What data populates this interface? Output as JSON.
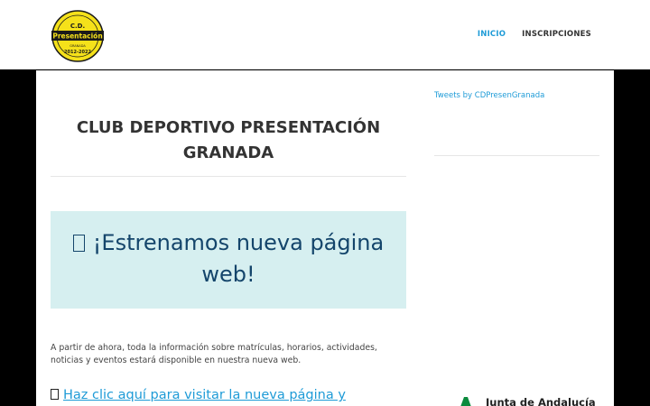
{
  "header": {
    "logo": {
      "line1": "C.D.",
      "line2": "Presentación",
      "line3": "GRANADA",
      "line4": "2012-2022",
      "colors": {
        "ring": "#f5e11a",
        "band": "#1a1a1a"
      }
    },
    "nav": [
      {
        "label": "INICIO",
        "active": true
      },
      {
        "label": "INSCRIPCIONES",
        "active": false
      }
    ]
  },
  "main": {
    "title": "CLUB DEPORTIVO PRESENTACIÓN GRANADA",
    "notice": {
      "icon": "megaphone-icon",
      "text": "¡Estrenamos nueva página web!"
    },
    "body_text": "A partir de ahora, toda la información sobre matrículas, horarios, actividades, noticias y eventos estará disponible en nuestra nueva web.",
    "link": {
      "icon": "pointing-hand-icon",
      "text": "Haz clic aquí para visitar la nueva página y"
    }
  },
  "sidebar": {
    "tweets_link": "Tweets by CDPresenGranada",
    "junta": {
      "name": "Junta de Andalucía",
      "icon": "junta-andalucia-emblem",
      "color": "#0b8a3d"
    }
  },
  "colors": {
    "accent": "#1e9bd7",
    "notice_bg": "#d6eff0",
    "notice_text": "#14456b"
  }
}
